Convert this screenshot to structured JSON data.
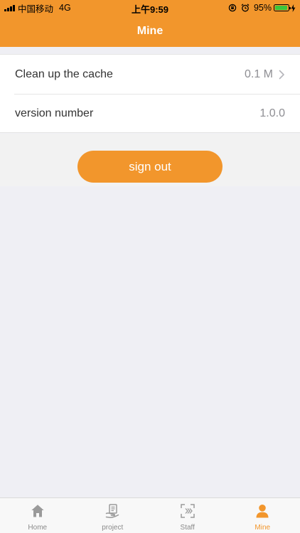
{
  "status_bar": {
    "carrier": "中国移动",
    "network": "4G",
    "time": "上午9:59",
    "battery_percent": "95%",
    "battery_level": 0.95,
    "battery_color": "#3CC53C"
  },
  "colors": {
    "accent": "#F2962C",
    "page_background": "#EFEFF4"
  },
  "header": {
    "title": "Mine"
  },
  "settings": {
    "items": [
      {
        "label": "Clean up the cache",
        "value": "0.1 M",
        "chevron": true
      },
      {
        "label": "version number",
        "value": "1.0.0",
        "chevron": false
      }
    ]
  },
  "actions": {
    "sign_out_label": "sign out"
  },
  "tab_bar": {
    "active_index": 3,
    "items": [
      {
        "label": "Home",
        "icon": "home-icon"
      },
      {
        "label": "project",
        "icon": "project-icon"
      },
      {
        "label": "Staff",
        "icon": "staff-icon"
      },
      {
        "label": "Mine",
        "icon": "person-icon"
      }
    ]
  }
}
